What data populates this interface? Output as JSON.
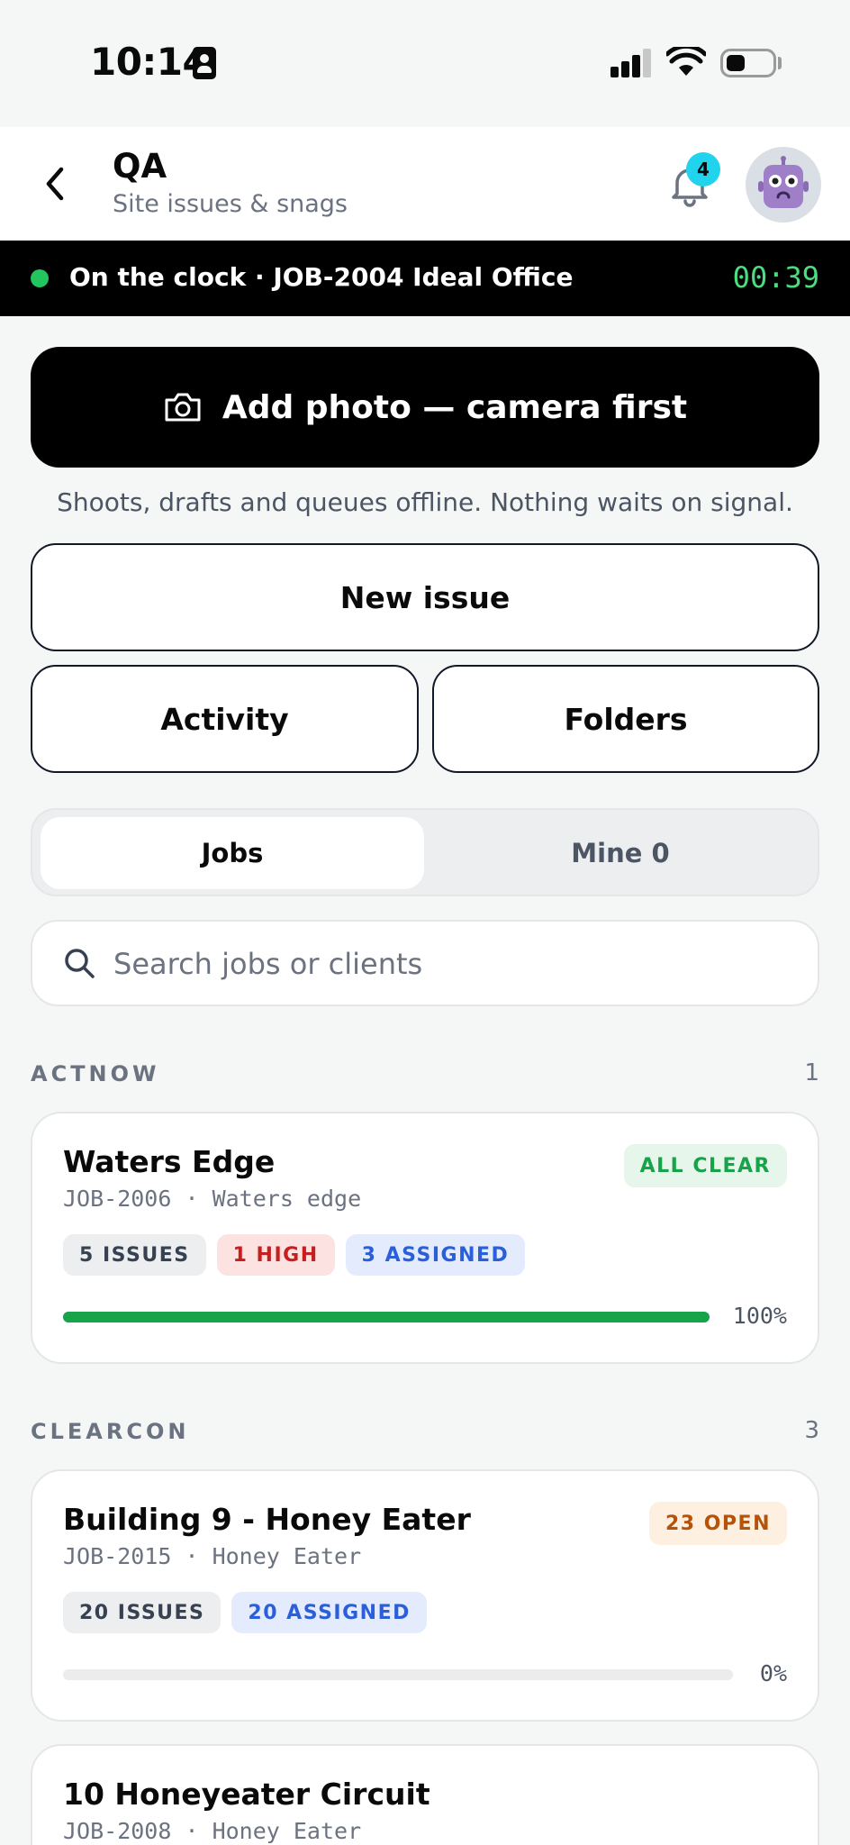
{
  "status_bar": {
    "time": "10:14"
  },
  "header": {
    "title": "QA",
    "subtitle": "Site issues & snags",
    "notification_count": "4"
  },
  "clock": {
    "text": "On the clock · JOB-2004 Ideal Office",
    "timer": "00:39"
  },
  "camera_button": {
    "label": "Add photo — camera first",
    "hint": "Shoots, drafts and queues offline. Nothing waits on signal."
  },
  "actions": {
    "new_issue": "New issue",
    "activity": "Activity",
    "folders": "Folders"
  },
  "tabs": [
    {
      "label": "Jobs",
      "active": true
    },
    {
      "label": "Mine 0",
      "active": false
    }
  ],
  "search": {
    "placeholder": "Search jobs or clients",
    "value": ""
  },
  "groups": [
    {
      "label": "ACTNOW",
      "count": "1",
      "jobs": [
        {
          "title": "Waters Edge",
          "meta": "JOB-2006 · Waters edge",
          "status": "ALL CLEAR",
          "tags": [
            "5 ISSUES",
            "1 HIGH",
            "3 ASSIGNED"
          ],
          "progress": 1.0,
          "progress_label": "100%"
        }
      ]
    },
    {
      "label": "CLEARCON",
      "count": "3",
      "jobs": [
        {
          "title": "Building 9 - Honey Eater",
          "meta": "JOB-2015 · Honey Eater",
          "status": "23 OPEN",
          "tags": [
            "20 ISSUES",
            "20 ASSIGNED"
          ],
          "progress": 0.0,
          "progress_label": "0%"
        },
        {
          "title": "10 Honeyeater Circuit",
          "meta": "JOB-2008 · Honey Eater"
        }
      ]
    }
  ],
  "colors": {
    "clock_dot": "#22c55e",
    "timer": "#4ade80",
    "badge": "#22d3ee",
    "all_clear_bg": "#e6f6ea",
    "all_clear_text": "#16a34a",
    "open_bg": "#fdf0e0",
    "open_text": "#b45309",
    "progress": "#16a34a"
  }
}
